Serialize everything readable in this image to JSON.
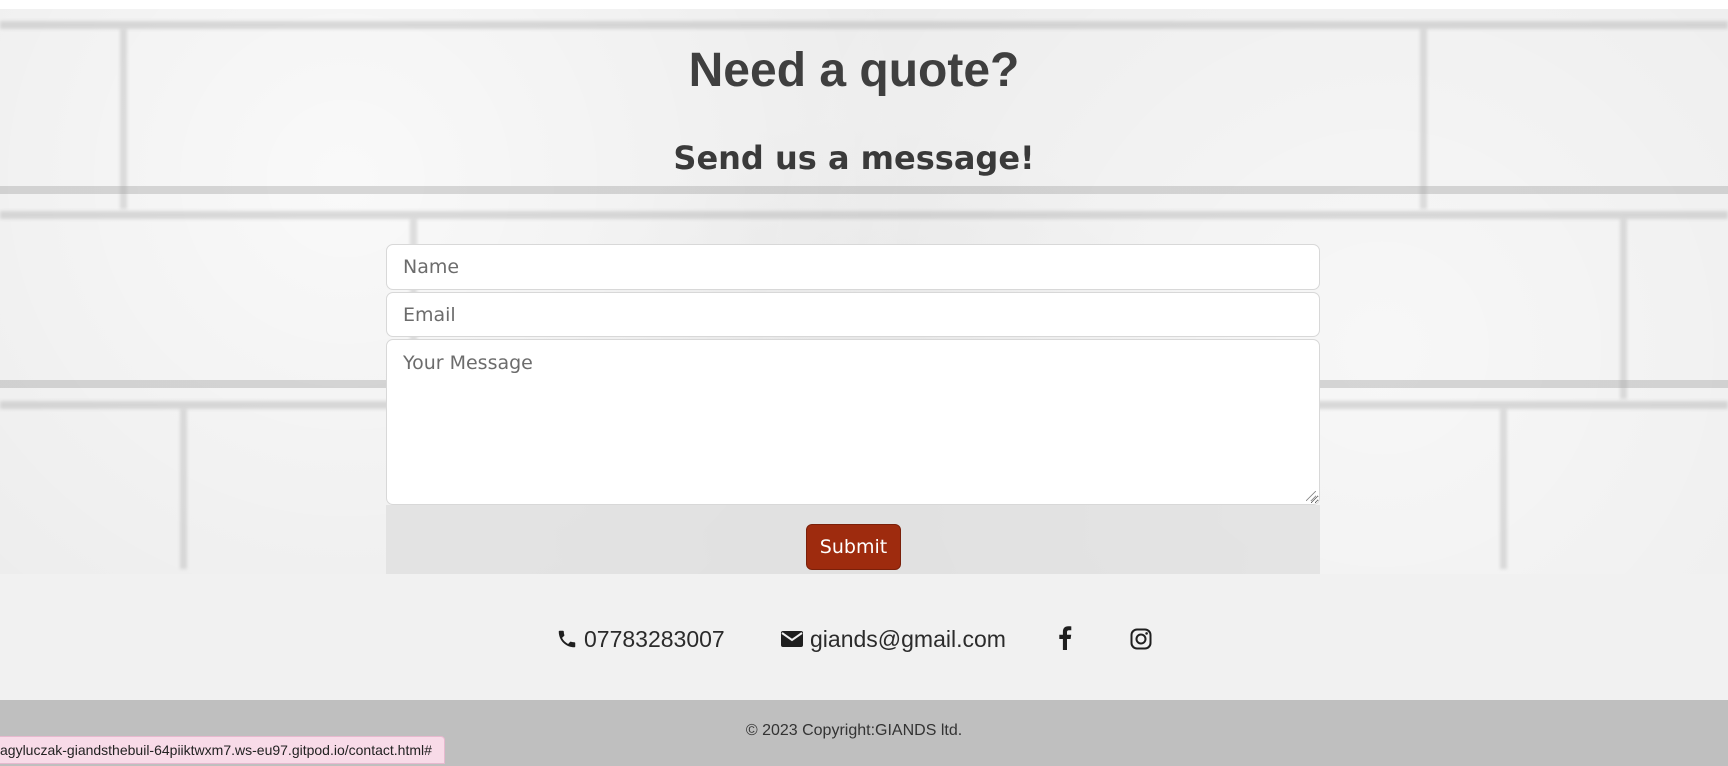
{
  "hero": {
    "title": "Need a quote?",
    "subtitle": "Send us a message!"
  },
  "form": {
    "name_placeholder": "Name",
    "email_placeholder": "Email",
    "message_placeholder": "Your Message",
    "submit_label": "Submit",
    "submit_color": "#9e2b0e"
  },
  "contact": {
    "phone": "07783283007",
    "phone_icon": "phone-icon",
    "email": "giands@gmail.com",
    "email_icon": "envelope-icon",
    "social_icons": [
      "facebook-icon",
      "instagram-icon"
    ]
  },
  "footer": {
    "copyright": "© 2023 Copyright:GIANDS ltd."
  },
  "status_bar": {
    "url": "agyluczak-giandsthebuil-64piiktwxm7.ws-eu97.gitpod.io/contact.html#"
  }
}
